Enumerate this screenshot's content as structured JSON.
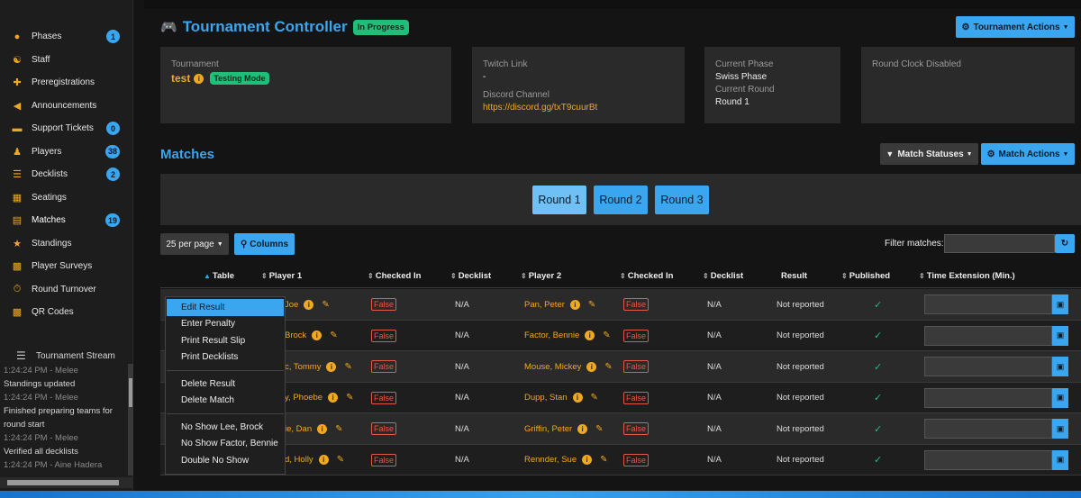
{
  "sidebar": {
    "items": [
      {
        "label": "Phases",
        "badge": "1",
        "icon": "people-icon"
      },
      {
        "label": "Staff",
        "badge": "",
        "icon": "staff-icon"
      },
      {
        "label": "Preregistrations",
        "badge": "",
        "icon": "user-plus-icon"
      },
      {
        "label": "Announcements",
        "badge": "",
        "icon": "megaphone-icon"
      },
      {
        "label": "Support Tickets",
        "badge": "0",
        "icon": "ticket-icon"
      },
      {
        "label": "Players",
        "badge": "38",
        "icon": "users-icon"
      },
      {
        "label": "Decklists",
        "badge": "2",
        "icon": "list-icon"
      },
      {
        "label": "Seatings",
        "badge": "",
        "icon": "chair-icon"
      },
      {
        "label": "Matches",
        "badge": "19",
        "icon": "clipboard-icon"
      },
      {
        "label": "Standings",
        "badge": "",
        "icon": "trophy-icon"
      },
      {
        "label": "Player Surveys",
        "badge": "",
        "icon": "chart-icon"
      },
      {
        "label": "Round Turnover",
        "badge": "",
        "icon": "stopwatch-icon"
      },
      {
        "label": "QR Codes",
        "badge": "",
        "icon": "qrcode-icon"
      }
    ],
    "stream_title": "Tournament Stream",
    "stream": [
      {
        "time": "1:24:24 PM - Melee",
        "msg": "Standings updated"
      },
      {
        "time": "1:24:24 PM - Melee",
        "msg": "Finished preparing teams for round start"
      },
      {
        "time": "1:24:24 PM - Melee",
        "msg": "Verified all decklists"
      },
      {
        "time": "1:24:24 PM - Aine Hadera",
        "msg": ""
      }
    ]
  },
  "header": {
    "title": "Tournament Controller",
    "status": "In Progress",
    "actions_label": "Tournament Actions"
  },
  "cards": {
    "tournament_label": "Tournament",
    "tournament_name": "test",
    "mode": "Testing Mode",
    "twitch_label": "Twitch Link",
    "twitch_value": "-",
    "discord_label": "Discord Channel",
    "discord_value": "https://discord.gg/txT9cuurBt",
    "phase_label": "Current Phase",
    "phase_value": "Swiss Phase",
    "round_label": "Current Round",
    "round_value": "Round 1",
    "clock": "Round Clock Disabled"
  },
  "matches": {
    "title": "Matches",
    "statuses_label": "Match Statuses",
    "actions_label": "Match Actions",
    "rounds": [
      "Round 1",
      "Round 2",
      "Round 3"
    ],
    "per_page": "25 per page",
    "columns_label": "Columns",
    "filter_label": "Filter matches:"
  },
  "table": {
    "headers": [
      "Table",
      "Player 1",
      "Checked In",
      "Decklist",
      "Player 2",
      "Checked In",
      "Decklist",
      "Result",
      "Published",
      "Time Extension (Min.)"
    ],
    "rows": [
      {
        "p1": "Joe",
        "c1": "False",
        "d1": "N/A",
        "p2": "Pan, Peter",
        "c2": "False",
        "d2": "N/A",
        "result": "Not reported"
      },
      {
        "p1": "Brock",
        "c1": "False",
        "d1": "N/A",
        "p2": "Factor, Bennie",
        "c2": "False",
        "d2": "N/A",
        "result": "Not reported"
      },
      {
        "p1": "c, Tommy",
        "c1": "False",
        "d1": "N/A",
        "p2": "Mouse, Mickey",
        "c2": "False",
        "d2": "N/A",
        "result": "Not reported"
      },
      {
        "p1": "y, Phoebe",
        "c1": "False",
        "d1": "N/A",
        "p2": "Dupp, Stan",
        "c2": "False",
        "d2": "N/A",
        "result": "Not reported"
      },
      {
        "p1": "ie, Dan",
        "c1": "False",
        "d1": "N/A",
        "p2": "Griffin, Peter",
        "c2": "False",
        "d2": "N/A",
        "result": "Not reported"
      },
      {
        "p1": "d, Holly",
        "c1": "False",
        "d1": "N/A",
        "p2": "Rennder, Sue",
        "c2": "False",
        "d2": "N/A",
        "result": "Not reported"
      }
    ]
  },
  "context_menu": {
    "group1": [
      "Edit Result",
      "Enter Penalty",
      "Print Result Slip",
      "Print Decklists"
    ],
    "group2": [
      "Delete Result",
      "Delete Match"
    ],
    "group3": [
      "No Show Lee, Brock",
      "No Show Factor, Bennie",
      "Double No Show"
    ]
  },
  "colors": {
    "accent": "#3aa6f0",
    "orange": "#f0a81e",
    "success": "#1fbf7a",
    "danger": "#e05a4a"
  }
}
